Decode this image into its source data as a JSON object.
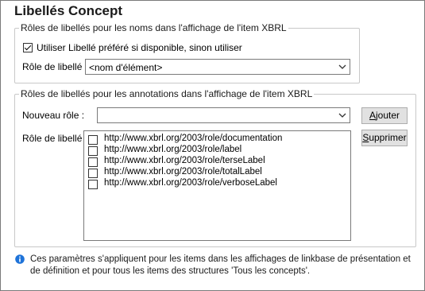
{
  "title": "Libellés Concept",
  "group1": {
    "legend": "Rôles de libellés pour les noms dans l'affichage de l'item XBRL",
    "use_preferred_label": "Utiliser Libellé préféré si disponible, sinon utiliser",
    "use_preferred_checked": true,
    "label_role_caption": "Rôle de libellé :",
    "label_role_value": "<nom d'élément>"
  },
  "group2": {
    "legend": "Rôles de libellés pour les annotations dans l'affichage de l'item XBRL",
    "new_role_caption": "Nouveau rôle :",
    "new_role_value": "",
    "add_button": {
      "accel": "A",
      "rest": "jouter"
    },
    "label_role_caption": "Rôle de libellé :",
    "delete_button": {
      "accel": "S",
      "rest": "upprimer"
    },
    "roles": [
      {
        "label": "http://www.xbrl.org/2003/role/documentation",
        "checked": false
      },
      {
        "label": "http://www.xbrl.org/2003/role/label",
        "checked": false
      },
      {
        "label": "http://www.xbrl.org/2003/role/terseLabel",
        "checked": false
      },
      {
        "label": "http://www.xbrl.org/2003/role/totalLabel",
        "checked": false
      },
      {
        "label": "http://www.xbrl.org/2003/role/verboseLabel",
        "checked": false
      }
    ]
  },
  "note": {
    "icon": "info-icon",
    "text": "Ces paramètres s'appliquent pour les items dans les affichages de linkbase de présentation et de définition et pour tous les items des structures 'Tous les concepts'."
  },
  "colors": {
    "accent": "#1e73d9",
    "border": "#7a7a7a",
    "button": "#e1e1e1"
  }
}
